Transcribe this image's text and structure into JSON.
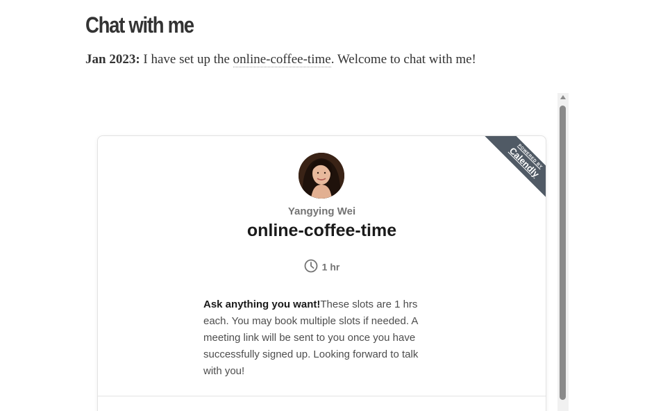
{
  "page": {
    "title": "Chat with me",
    "announcement": {
      "date_label": "Jan 2023:",
      "text_before_link": " I have set up the ",
      "link_text": "online-coffee-time",
      "text_after_link": ". Welcome to chat with me!"
    }
  },
  "calendly": {
    "ribbon": {
      "powered_by": "POWERED BY",
      "brand": "Calendly"
    },
    "host_name": "Yangying Wei",
    "event_title": "online-coffee-time",
    "duration": {
      "icon": "clock-icon",
      "label": "1 hr"
    },
    "description": {
      "bold": "Ask anything you want!",
      "text": "These slots are 1 hrs each. You may book multiple slots if needed. A meeting link will be sent to you once you have successfully signed up. Looking forward to talk with you!"
    }
  },
  "colors": {
    "ribbon": "#505a65",
    "text_dark": "#1a1a1a",
    "text_muted": "#737373",
    "scrollbar_thumb": "#8a8a8a"
  }
}
